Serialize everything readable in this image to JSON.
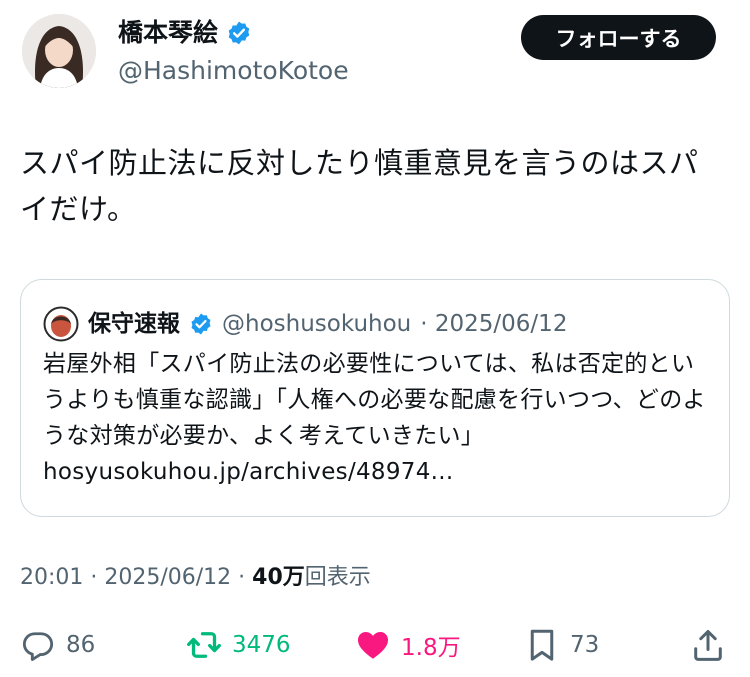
{
  "author": {
    "display_name": "橋本琴絵",
    "handle": "@HashimotoKotoe",
    "verified": true
  },
  "follow_button": {
    "label": "フォローする"
  },
  "tweet": {
    "text": "スパイ防止法に反対したり慎重意見を言うのはスパイだけ。"
  },
  "quote": {
    "display_name": "保守速報",
    "verified": true,
    "handle": "@hoshusokuhou",
    "date": "· 2025/06/12",
    "text": "岩屋外相「スパイ防止法の必要性については、私は否定的というよりも慎重な認識」「人権への必要な配慮を行いつつ、どのような対策が必要か、よく考えていきたい」 hosyusokuhou.jp/archives/48974..."
  },
  "meta": {
    "time": "20:01 · 2025/06/12 · ",
    "views_count": "40万",
    "views_label": "回表示"
  },
  "actions": {
    "replies": "86",
    "retweets": "3476",
    "likes": "1.8万",
    "bookmarks": "73"
  },
  "colors": {
    "verified": "#1d9bf0",
    "retweet": "#00ba7c",
    "like": "#f91880",
    "muted": "#536471"
  }
}
